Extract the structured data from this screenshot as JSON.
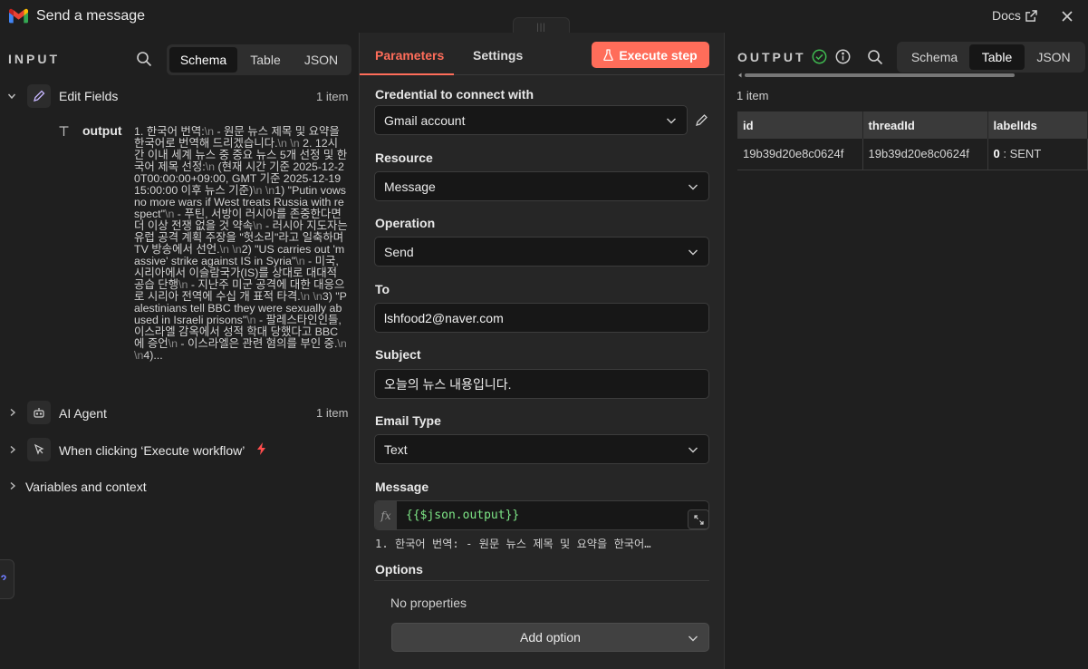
{
  "window": {
    "title": "Send a message",
    "docs_label": "Docs"
  },
  "input": {
    "panel_label": "INPUT",
    "views": [
      "Schema",
      "Table",
      "JSON"
    ],
    "active_view": "Schema",
    "nodes": [
      {
        "name": "Edit Fields",
        "count": "1 item",
        "expanded": true
      },
      {
        "name": "AI Agent",
        "count": "1 item",
        "expanded": false
      },
      {
        "name": "When clicking ‘Execute workflow’",
        "count": "",
        "expanded": false
      }
    ],
    "vars_label": "Variables and context",
    "field": {
      "name": "output",
      "value_parts": [
        {
          "t": "1. 한국어 번역:"
        },
        {
          "t": "\\n",
          "esc": true
        },
        {
          "t": " - 원문 뉴스 제목 및 요약을 한국어로 번역해 드리겠습니다."
        },
        {
          "t": "\\n \\n",
          "esc": true
        },
        {
          "t": " 2. 12시간 이내 세계 뉴스 중 중요 뉴스 5개 선정 및 한국어 제목 선정:"
        },
        {
          "t": "\\n",
          "esc": true
        },
        {
          "t": " (현재 시간 기준 2025-12-20T00:00:00+09:00, GMT 기준 2025-12-19 15:00:00 이후 뉴스 기준)"
        },
        {
          "t": "\\n \\n",
          "esc": true
        },
        {
          "t": "1) \"Putin vows no more wars if West treats Russia with respect\""
        },
        {
          "t": "\\n",
          "esc": true
        },
        {
          "t": " - 푸틴, 서방이 러시아를 존중한다면 더 이상 전쟁 없을 것 약속"
        },
        {
          "t": "\\n",
          "esc": true
        },
        {
          "t": " - 러시아 지도자는 유럽 공격 계획 주장을 \"헛소리\"라고 일축하며 TV 방송에서 선언."
        },
        {
          "t": "\\n \\n",
          "esc": true
        },
        {
          "t": "2) \"US carries out 'massive' strike against IS in Syria\""
        },
        {
          "t": "\\n",
          "esc": true
        },
        {
          "t": " - 미국, 시리아에서 이슬람국가(IS)를 상대로 대대적 공습 단행"
        },
        {
          "t": "\\n",
          "esc": true
        },
        {
          "t": " - 지난주 미군 공격에 대한 대응으로 시리아 전역에 수십 개 표적 타격."
        },
        {
          "t": "\\n \\n",
          "esc": true
        },
        {
          "t": "3) \"Palestinians tell BBC they were sexually abused in Israeli prisons\""
        },
        {
          "t": "\\n",
          "esc": true
        },
        {
          "t": " - 팔레스타인인들, 이스라엘 감옥에서 성적 학대 당했다고 BBC에 증언"
        },
        {
          "t": "\\n",
          "esc": true
        },
        {
          "t": " - 이스라엘은 관련 혐의를 부인 중."
        },
        {
          "t": "\\n \\n",
          "esc": true
        },
        {
          "t": "4)..."
        }
      ]
    }
  },
  "params": {
    "tabs": [
      "Parameters",
      "Settings"
    ],
    "active_tab": "Parameters",
    "execute_label": "Execute step",
    "credential_label": "Credential to connect with",
    "credential_value": "Gmail account",
    "resource_label": "Resource",
    "resource_value": "Message",
    "operation_label": "Operation",
    "operation_value": "Send",
    "to_label": "To",
    "to_value": "lshfood2@naver.com",
    "subject_label": "Subject",
    "subject_value": "오늘의 뉴스 내용입니다.",
    "email_type_label": "Email Type",
    "email_type_value": "Text",
    "message_label": "Message",
    "message_fx": "fx",
    "message_expr": "{{$json.output}}",
    "message_preview": "1. 한국어 번역: - 원문 뉴스 제목 및 요약을 한국어…",
    "options_label": "Options",
    "no_properties": "No properties",
    "add_option": "Add option"
  },
  "output": {
    "panel_label": "OUTPUT",
    "views": [
      "Schema",
      "Table",
      "JSON"
    ],
    "active_view": "Table",
    "item_count": "1 item",
    "columns": [
      "id",
      "threadId",
      "labelIds"
    ],
    "row": {
      "id": "19b39d20e8c0624f",
      "threadId": "19b39d20e8c0624f",
      "label_index": "0",
      "label_value": ": SENT"
    }
  },
  "colors": {
    "accent": "#ff6d5a",
    "success": "#3fb950",
    "expression": "#7ee787",
    "lightning": "#ff4d4d"
  }
}
